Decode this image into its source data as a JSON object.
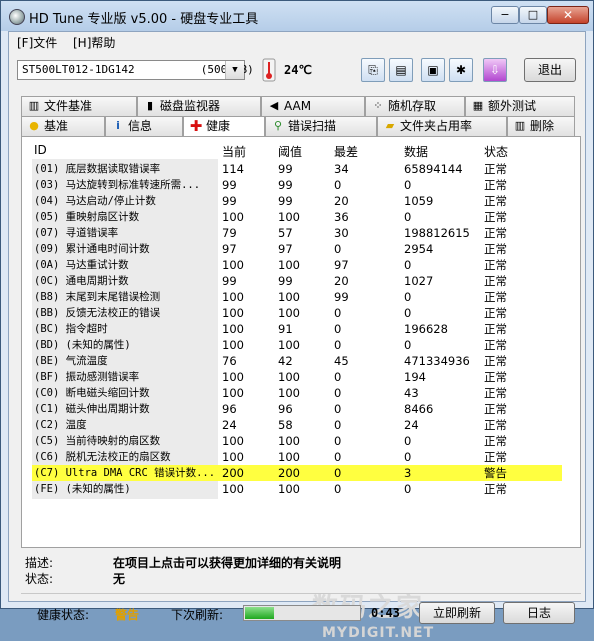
{
  "window": {
    "title": "HD Tune 专业版 v5.00 - 硬盘专业工具",
    "min_label": "−",
    "max_label": "□",
    "close_label": "✕"
  },
  "menu": [
    {
      "label": "[F]文件"
    },
    {
      "label": "[H]帮助"
    }
  ],
  "toolbar": {
    "drive": "ST500LT012-1DG142          (500 gB)",
    "temperature": "24℃",
    "exit_label": "退出"
  },
  "tabs_top": [
    {
      "label": "文件基准",
      "icon": "file-benchmark-icon"
    },
    {
      "label": "磁盘监视器",
      "icon": "disk-monitor-icon"
    },
    {
      "label": "AAM",
      "icon": "speaker-icon"
    },
    {
      "label": "随机存取",
      "icon": "random-access-icon"
    },
    {
      "label": "额外测试",
      "icon": "extra-tests-icon"
    }
  ],
  "tabs_bottom": [
    {
      "label": "基准",
      "icon": "benchmark-icon"
    },
    {
      "label": "信息",
      "icon": "info-icon"
    },
    {
      "label": "健康",
      "icon": "health-cross-icon"
    },
    {
      "label": "错误扫描",
      "icon": "error-scan-icon"
    },
    {
      "label": "文件夹占用率",
      "icon": "folder-usage-icon"
    },
    {
      "label": "删除",
      "icon": "trash-icon"
    }
  ],
  "smart": {
    "columns": [
      "ID",
      "当前",
      "阈值",
      "最差",
      "数据",
      "状态"
    ],
    "rows": [
      {
        "id": "(01) 底层数据读取错误率",
        "current": "114",
        "threshold": "99",
        "worst": "34",
        "data": "65894144",
        "status": "正常"
      },
      {
        "id": "(03) 马达旋转到标准转速所需...",
        "current": "99",
        "threshold": "99",
        "worst": "0",
        "data": "0",
        "status": "正常"
      },
      {
        "id": "(04) 马达启动/停止计数",
        "current": "99",
        "threshold": "99",
        "worst": "20",
        "data": "1059",
        "status": "正常"
      },
      {
        "id": "(05) 重映射扇区计数",
        "current": "100",
        "threshold": "100",
        "worst": "36",
        "data": "0",
        "status": "正常"
      },
      {
        "id": "(07) 寻道错误率",
        "current": "79",
        "threshold": "57",
        "worst": "30",
        "data": "198812615",
        "status": "正常"
      },
      {
        "id": "(09) 累计通电时间计数",
        "current": "97",
        "threshold": "97",
        "worst": "0",
        "data": "2954",
        "status": "正常"
      },
      {
        "id": "(0A) 马达重试计数",
        "current": "100",
        "threshold": "100",
        "worst": "97",
        "data": "0",
        "status": "正常"
      },
      {
        "id": "(0C) 通电周期计数",
        "current": "99",
        "threshold": "99",
        "worst": "20",
        "data": "1027",
        "status": "正常"
      },
      {
        "id": "(B8) 末尾到末尾错误检测",
        "current": "100",
        "threshold": "100",
        "worst": "99",
        "data": "0",
        "status": "正常"
      },
      {
        "id": "(BB) 反馈无法校正的错误",
        "current": "100",
        "threshold": "100",
        "worst": "0",
        "data": "0",
        "status": "正常"
      },
      {
        "id": "(BC) 指令超时",
        "current": "100",
        "threshold": "91",
        "worst": "0",
        "data": "196628",
        "status": "正常"
      },
      {
        "id": "(BD) (未知的属性)",
        "current": "100",
        "threshold": "100",
        "worst": "0",
        "data": "0",
        "status": "正常"
      },
      {
        "id": "(BE) 气流温度",
        "current": "76",
        "threshold": "42",
        "worst": "45",
        "data": "471334936",
        "status": "正常"
      },
      {
        "id": "(BF) 振动感测错误率",
        "current": "100",
        "threshold": "100",
        "worst": "0",
        "data": "194",
        "status": "正常"
      },
      {
        "id": "(C0) 断电磁头缩回计数",
        "current": "100",
        "threshold": "100",
        "worst": "0",
        "data": "43",
        "status": "正常"
      },
      {
        "id": "(C1) 磁头伸出周期计数",
        "current": "96",
        "threshold": "96",
        "worst": "0",
        "data": "8466",
        "status": "正常"
      },
      {
        "id": "(C2) 温度",
        "current": "24",
        "threshold": "58",
        "worst": "0",
        "data": "24",
        "status": "正常"
      },
      {
        "id": "(C5) 当前待映射的扇区数",
        "current": "100",
        "threshold": "100",
        "worst": "0",
        "data": "0",
        "status": "正常"
      },
      {
        "id": "(C6) 脱机无法校正的扇区数",
        "current": "100",
        "threshold": "100",
        "worst": "0",
        "data": "0",
        "status": "正常"
      },
      {
        "id": "(C7) Ultra DMA CRC 错误计数...",
        "current": "200",
        "threshold": "200",
        "worst": "0",
        "data": "3",
        "status": "警告"
      },
      {
        "id": "(FE) (未知的属性)",
        "current": "100",
        "threshold": "100",
        "worst": "0",
        "data": "0",
        "status": "正常"
      }
    ]
  },
  "watermark": {
    "text1": "数码之家",
    "text2": "MYDIGIT.NET"
  },
  "info": {
    "desc_label": "描述:",
    "desc_value": "在项目上点击可以获得更加详细的有关说明",
    "state_label": "状态:",
    "state_value": "无"
  },
  "footer": {
    "health_label": "健康状态:",
    "health_value": "警告",
    "health_color": "#e0a000",
    "next_refresh_label": "下次刷新:",
    "refresh_progress": 0.25,
    "time": "0:43",
    "refresh_button": "立即刷新",
    "log_button": "日志"
  }
}
